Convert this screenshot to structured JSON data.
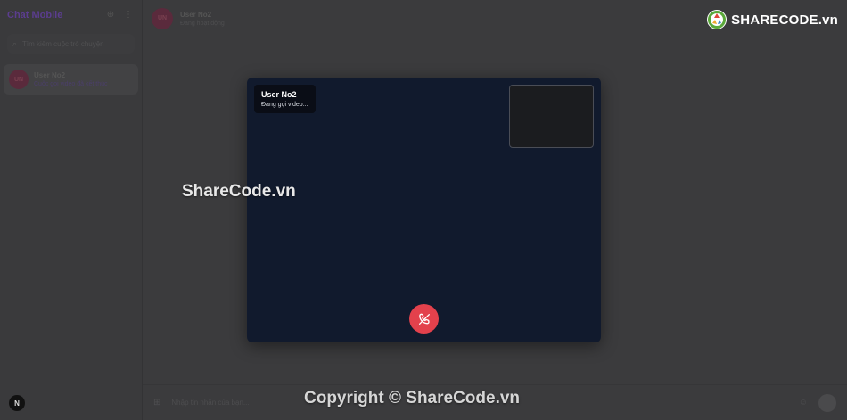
{
  "sidebar": {
    "brand": "Chat Mobile",
    "search_placeholder": "Tìm kiếm cuộc trò chuyện",
    "conversation": {
      "avatar_initials": "UN",
      "name": "User No2",
      "last_message": "Cuộc gọi video đã kết thúc"
    },
    "footer_badge": "N"
  },
  "chat": {
    "avatar_initials": "UN",
    "name": "User No2",
    "status": "Đang hoạt động",
    "composer_placeholder": "Nhập tin nhắn của bạn..."
  },
  "call": {
    "caller_name": "User No2",
    "status": "Đang gọi video...",
    "end_call_icon": "phone-hangup-icon",
    "accent_color": "#e3414c"
  },
  "watermarks": {
    "logo_text": "SHARECODE.vn",
    "center": "ShareCode.vn",
    "bottom": "Copyright © ShareCode.vn"
  }
}
